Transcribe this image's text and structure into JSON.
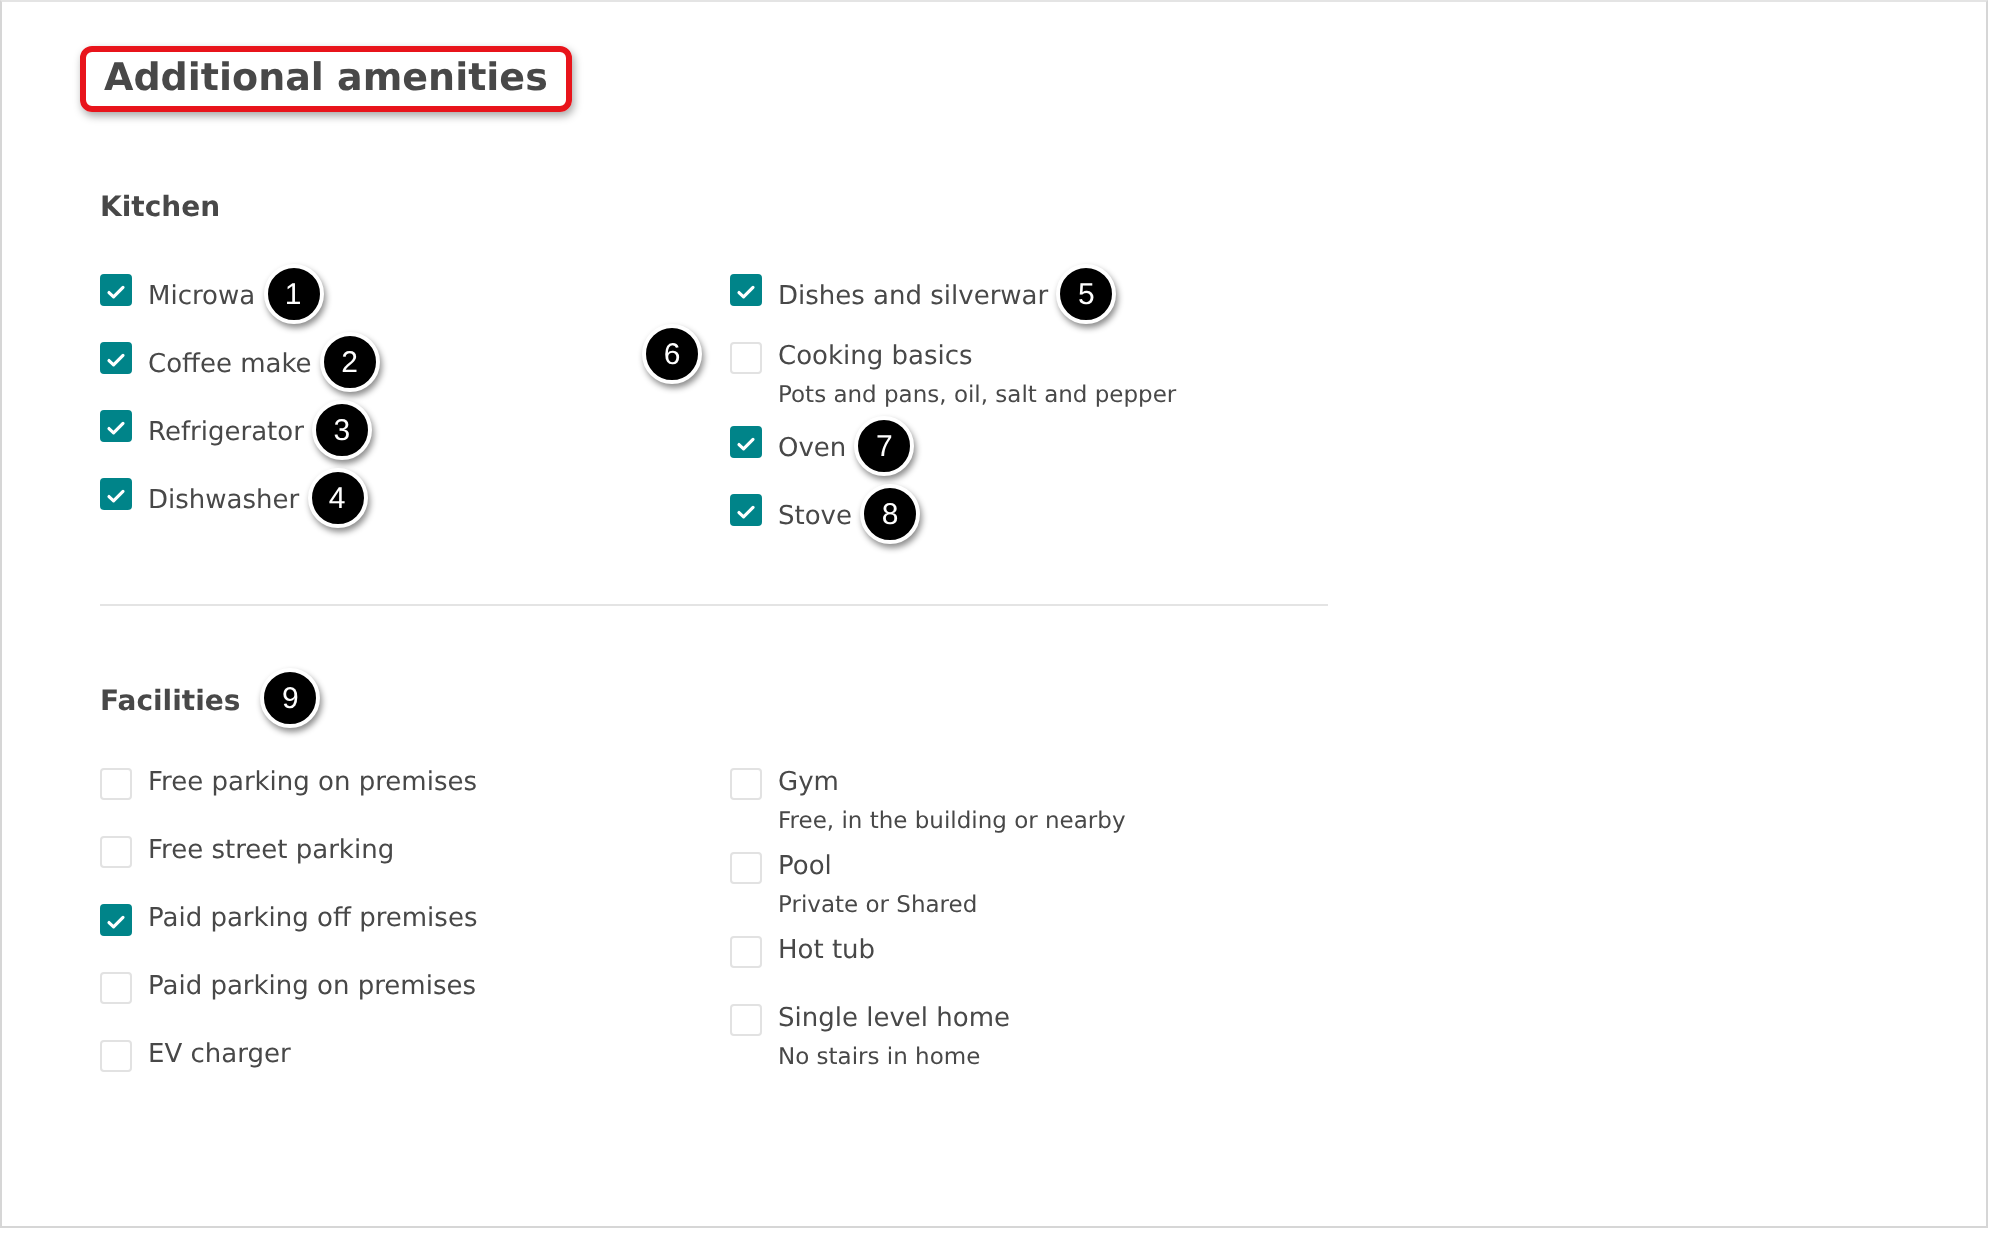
{
  "title": "Additional amenities",
  "sections": [
    {
      "heading": "Kitchen",
      "columns": [
        [
          {
            "label": "Microwa",
            "checked": true,
            "callout": "1"
          },
          {
            "label": "Coffee make",
            "checked": true,
            "callout": "2"
          },
          {
            "label": "Refrigerator",
            "checked": true,
            "callout": "3"
          },
          {
            "label": "Dishwasher",
            "checked": true,
            "callout": "4"
          }
        ],
        [
          {
            "label": "Dishes and silverwar",
            "checked": true,
            "callout": "5"
          },
          {
            "label": "Cooking basics",
            "note": "Pots and pans, oil, salt and pepper",
            "checked": false,
            "callout": "6",
            "kind": "left-callout"
          },
          {
            "label": "Oven",
            "checked": true,
            "callout": "7"
          },
          {
            "label": "Stove",
            "checked": true,
            "callout": "8"
          }
        ]
      ]
    },
    {
      "heading": "Facilities",
      "callout": "9",
      "columns": [
        [
          {
            "label": "Free parking on premises",
            "checked": false
          },
          {
            "label": "Free street parking",
            "checked": false
          },
          {
            "label": "Paid parking off premises",
            "checked": true
          },
          {
            "label": "Paid parking on premises",
            "checked": false
          },
          {
            "label": "EV charger",
            "checked": false
          }
        ],
        [
          {
            "label": "Gym",
            "note": "Free, in the building or nearby",
            "checked": false
          },
          {
            "label": "Pool",
            "note": "Private or Shared",
            "checked": false
          },
          {
            "label": "Hot tub",
            "checked": false
          },
          {
            "label": "Single level home",
            "note": "No stairs in home",
            "checked": false
          }
        ]
      ]
    }
  ]
}
